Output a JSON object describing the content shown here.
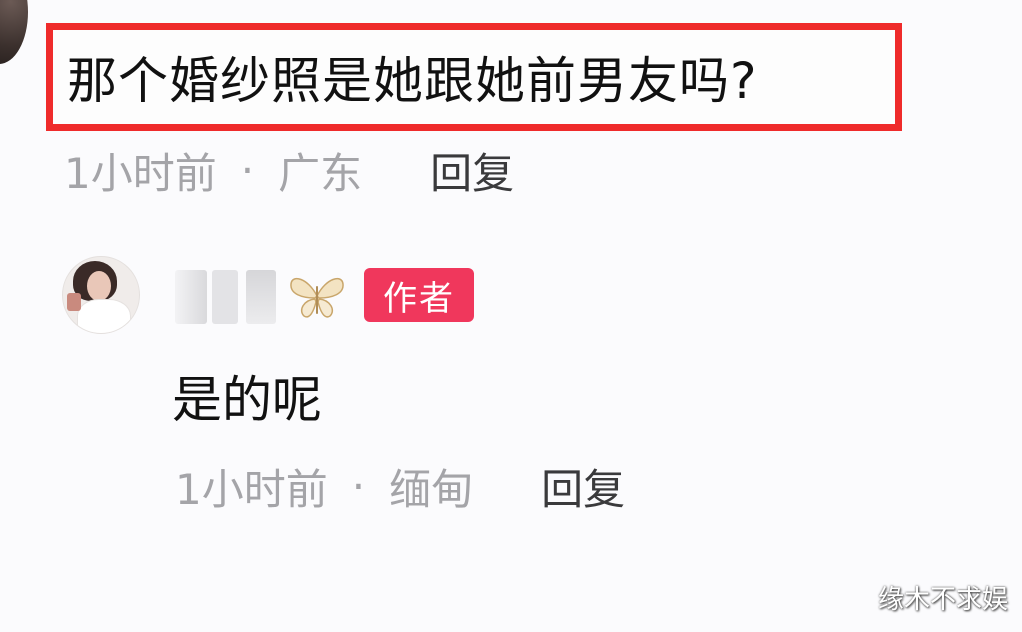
{
  "question": {
    "text": "那个婚纱照是她跟她前男友吗?",
    "meta": {
      "time": "1小时前",
      "separator": "·",
      "location": "广东",
      "reply_label": "回复"
    }
  },
  "author_reply": {
    "author_badge": "作者",
    "text": "是的呢",
    "meta": {
      "time": "1小时前",
      "separator": "·",
      "location": "缅甸",
      "reply_label": "回复"
    }
  },
  "watermark": "缘木不求娱",
  "colors": {
    "highlight_border": "#ef2b2b",
    "author_badge": "#f0375c",
    "meta_text": "#a4a4a8"
  },
  "icons": {
    "name_decoration": "butterfly-icon"
  }
}
